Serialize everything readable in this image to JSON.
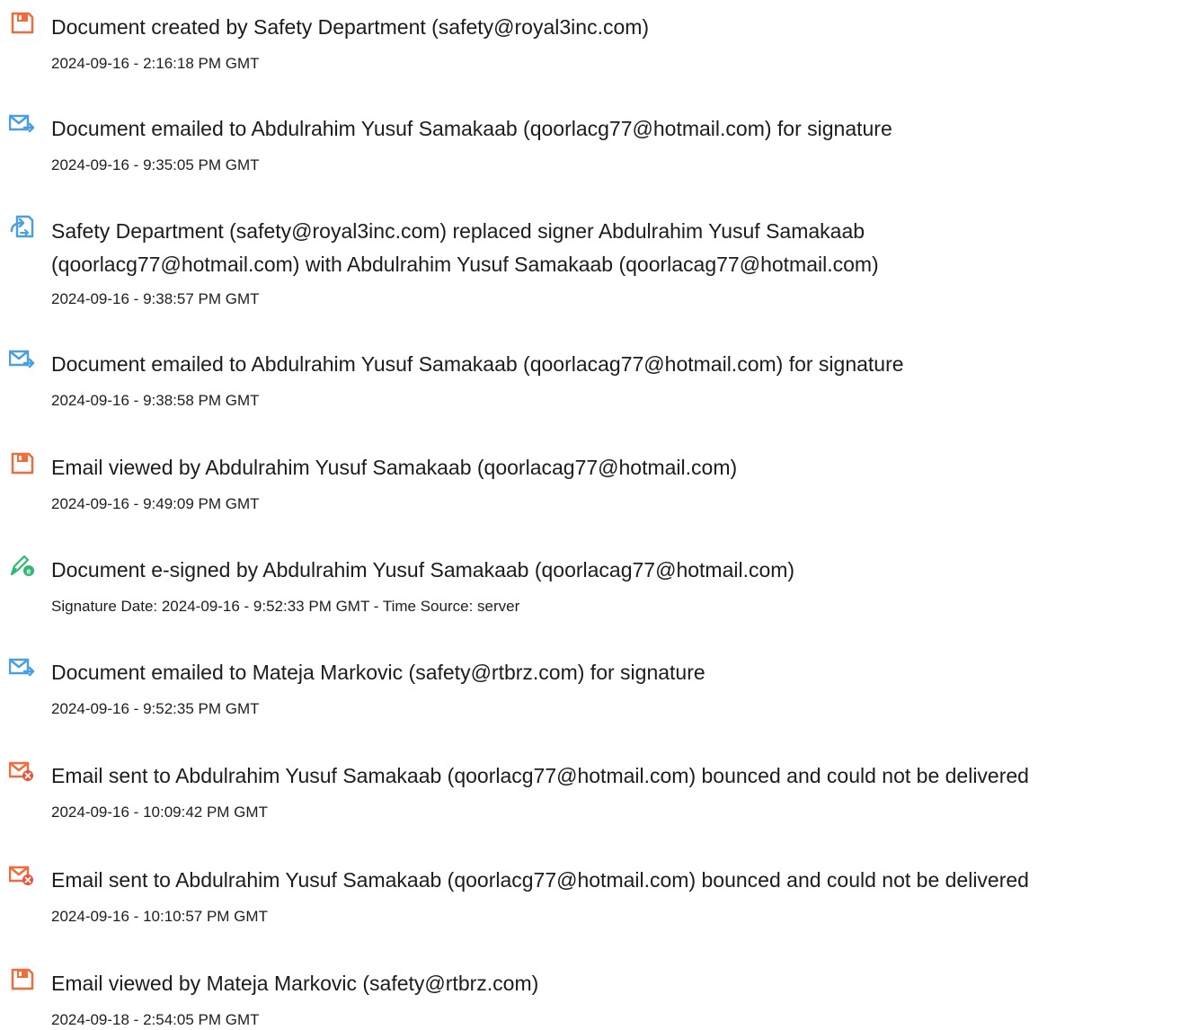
{
  "events": [
    {
      "icon": "document-created-icon",
      "title": "Document created by Safety Department (safety@royal3inc.com)",
      "meta": "2024-09-16 - 2:16:18 PM GMT"
    },
    {
      "icon": "email-sent-icon",
      "title": "Document emailed to Abdulrahim Yusuf Samakaab (qoorlacg77@hotmail.com) for signature",
      "meta": "2024-09-16 - 9:35:05 PM GMT"
    },
    {
      "icon": "signer-replaced-icon",
      "title": "Safety Department (safety@royal3inc.com) replaced signer Abdulrahim Yusuf Samakaab (qoorlacg77@hotmail.com) with Abdulrahim Yusuf Samakaab (qoorlacag77@hotmail.com)",
      "meta": "2024-09-16 - 9:38:57 PM GMT"
    },
    {
      "icon": "email-sent-icon",
      "title": "Document emailed to Abdulrahim Yusuf Samakaab (qoorlacag77@hotmail.com) for signature",
      "meta": "2024-09-16 - 9:38:58 PM GMT"
    },
    {
      "icon": "email-viewed-icon",
      "title": "Email viewed by Abdulrahim Yusuf Samakaab (qoorlacag77@hotmail.com)",
      "meta": "2024-09-16 - 9:49:09 PM GMT"
    },
    {
      "icon": "e-signed-icon",
      "title": "Document e-signed by Abdulrahim Yusuf Samakaab (qoorlacag77@hotmail.com)",
      "meta": "Signature Date: 2024-09-16 - 9:52:33 PM GMT - Time Source: server"
    },
    {
      "icon": "email-sent-icon",
      "title": "Document emailed to Mateja Markovic (safety@rtbrz.com) for signature",
      "meta": "2024-09-16 - 9:52:35 PM GMT"
    },
    {
      "icon": "email-bounced-icon",
      "title": "Email sent to Abdulrahim Yusuf Samakaab (qoorlacg77@hotmail.com) bounced and could not be delivered",
      "meta": "2024-09-16 - 10:09:42 PM GMT"
    },
    {
      "icon": "email-bounced-icon",
      "title": "Email sent to Abdulrahim Yusuf Samakaab (qoorlacg77@hotmail.com) bounced and could not be delivered",
      "meta": "2024-09-16 - 10:10:57 PM GMT"
    },
    {
      "icon": "email-viewed-icon",
      "title": "Email viewed by Mateja Markovic (safety@rtbrz.com)",
      "meta": "2024-09-18 - 2:54:05 PM GMT"
    }
  ],
  "colors": {
    "document_orange": "#f26b3a",
    "email_blue": "#4a9fe0",
    "sign_green": "#2eb872",
    "bounce_red": "#e8543d"
  }
}
